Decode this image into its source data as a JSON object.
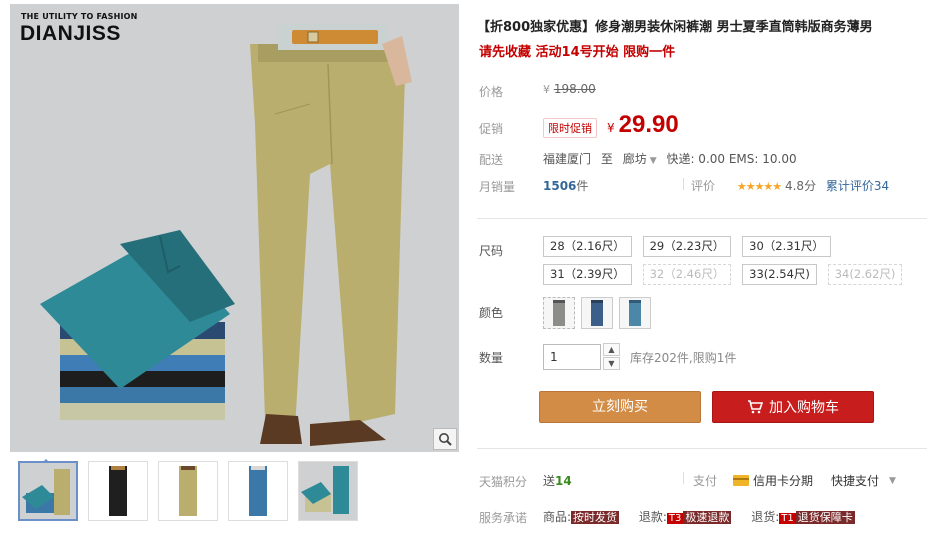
{
  "brand": {
    "tagline": "THE UTILITY TO FASHION",
    "name": "DIANJISS"
  },
  "product": {
    "title": "【折800独家优惠】修身潮男装休闲裤潮 男士夏季直筒韩版商务薄男",
    "subtitle": "请先收藏 活动14号开始 限购一件"
  },
  "pricing": {
    "price_label": "价格",
    "currency": "¥",
    "original_price": "198.00",
    "promo_label": "促销",
    "promo_badge": "限时促销",
    "promo_price": "29.90"
  },
  "shipping": {
    "label": "配送",
    "from": "福建厦门",
    "to_word": "至",
    "destination": "廊坊",
    "fees": "快递: 0.00 EMS: 10.00"
  },
  "sales": {
    "label": "月销量",
    "count": "1506",
    "unit": "件",
    "rating_label": "评价",
    "stars": "★★★★★",
    "score": "4.8分",
    "reviews": "累计评价34"
  },
  "options": {
    "size_label": "尺码",
    "sizes": [
      {
        "text": "28（2.16尺）",
        "disabled": false
      },
      {
        "text": "29（2.23尺）",
        "disabled": false
      },
      {
        "text": "30（2.31尺）",
        "disabled": false
      },
      {
        "text": "31（2.39尺）",
        "disabled": false
      },
      {
        "text": "32（2.46尺）",
        "disabled": true
      },
      {
        "text": "33(2.54尺)",
        "disabled": false
      },
      {
        "text": "34(2.62尺)",
        "disabled": true
      }
    ],
    "color_label": "颜色",
    "color_swatches": [
      "#8c8d89",
      "#3c5f8a",
      "#4d87a8"
    ],
    "qty_label": "数量",
    "qty_value": "1",
    "stock": "库存202件,限购1件"
  },
  "actions": {
    "buy_now": "立刻购买",
    "add_to_cart": "加入购物车"
  },
  "points": {
    "label": "天猫积分",
    "prefix": "送",
    "value": "14",
    "pay_label": "支付",
    "pay_option": "信用卡分期",
    "quick_pay": "快捷支付"
  },
  "service": {
    "label": "服务承诺",
    "goods_label": "商品:",
    "goods_tag": "按时发货",
    "refund_label": "退款:",
    "refund_tag_code": "T3",
    "refund_tag": "极速退款",
    "return_label": "退货:",
    "return_tag_code": "T1",
    "return_tag": "退货保障卡"
  },
  "colors": {
    "price_red": "#c40000",
    "buy_orange": "#d28c45",
    "cart_red": "#c81d1d",
    "link_blue": "#336699",
    "khaki_pants": "#b9ae6e",
    "teal_shorts": "#2f8a97"
  },
  "gallery": {
    "thumb_colors": [
      "#b9ae6e",
      "#1f1f1f",
      "#b9ae6e",
      "#3b78a8",
      "#2f8a97"
    ]
  }
}
